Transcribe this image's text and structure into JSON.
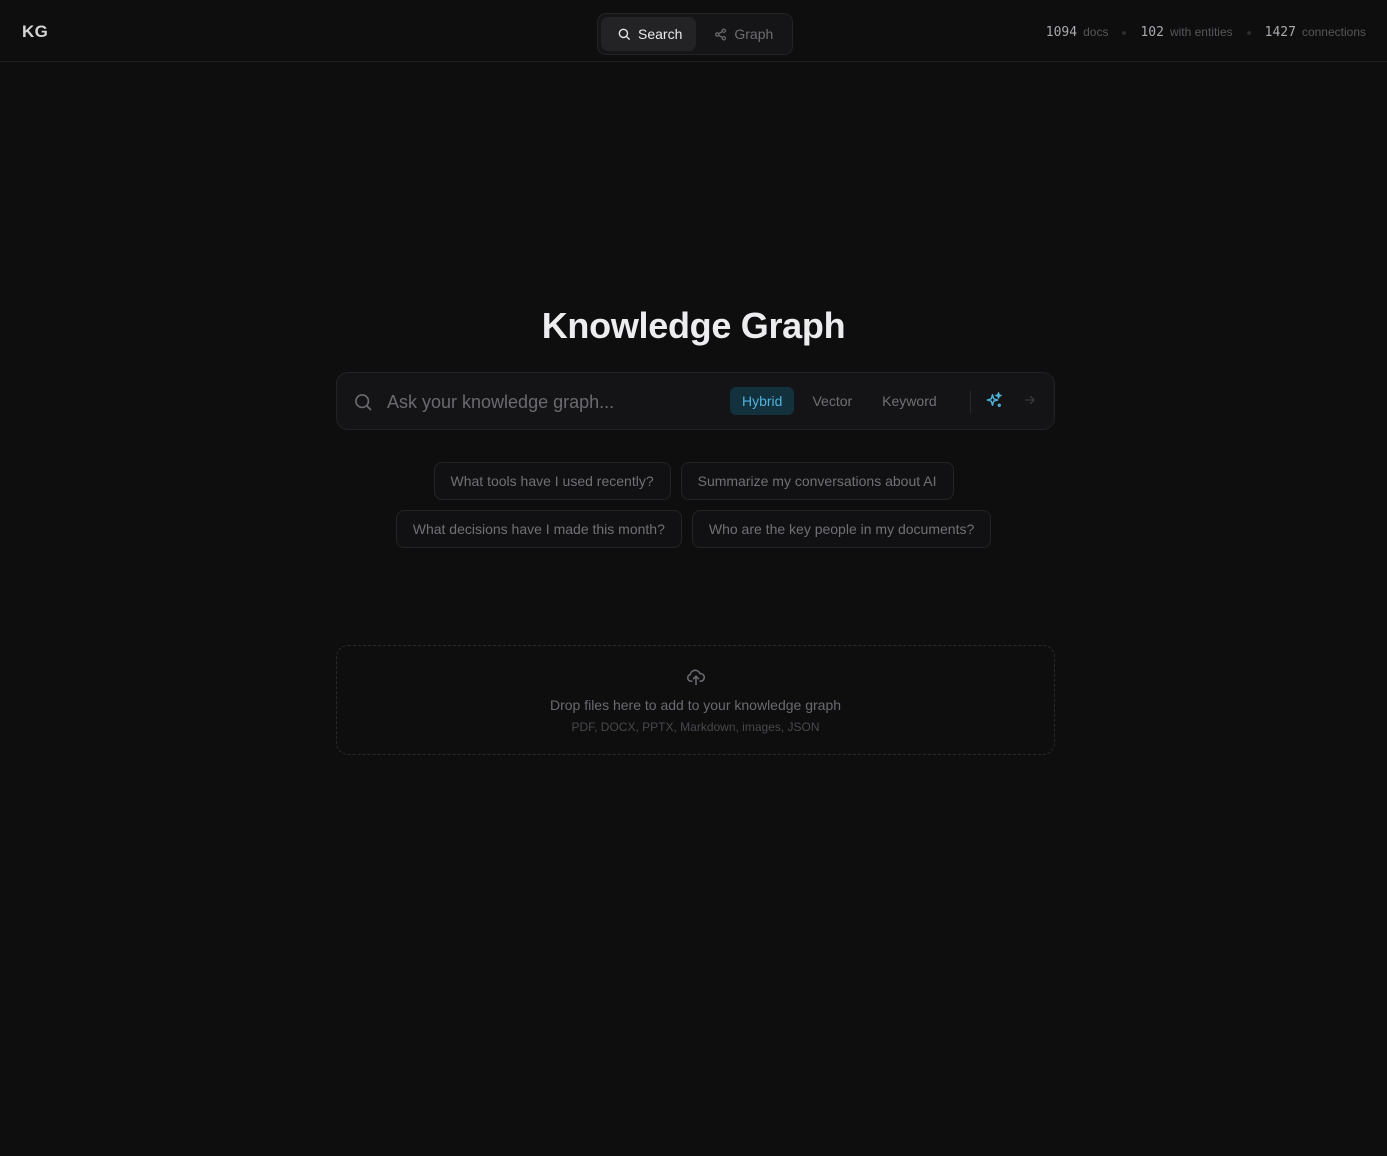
{
  "header": {
    "logo": "KG",
    "tabs": [
      {
        "label": "Search",
        "icon": "search-icon",
        "active": true
      },
      {
        "label": "Graph",
        "icon": "share-graph-icon",
        "active": false
      }
    ],
    "stats": [
      {
        "value": "1094",
        "label": "docs"
      },
      {
        "value": "102",
        "label": "with entities"
      },
      {
        "value": "1427",
        "label": "connections"
      }
    ]
  },
  "main": {
    "title": "Knowledge Graph",
    "search": {
      "placeholder": "Ask your knowledge graph...",
      "value": "",
      "modes": [
        "Hybrid",
        "Vector",
        "Keyword"
      ],
      "active_mode": "Hybrid"
    },
    "suggestions": [
      "What tools have I used recently?",
      "Summarize my conversations about AI",
      "What decisions have I made this month?",
      "Who are the key people in my documents?"
    ],
    "dropzone": {
      "title": "Drop files here to add to your knowledge graph",
      "formats": "PDF, DOCX, PPTX, Markdown, images, JSON"
    }
  },
  "colors": {
    "background": "#0e0e0f",
    "accent": "#4fb3dc",
    "accent_bg": "#13303d"
  }
}
